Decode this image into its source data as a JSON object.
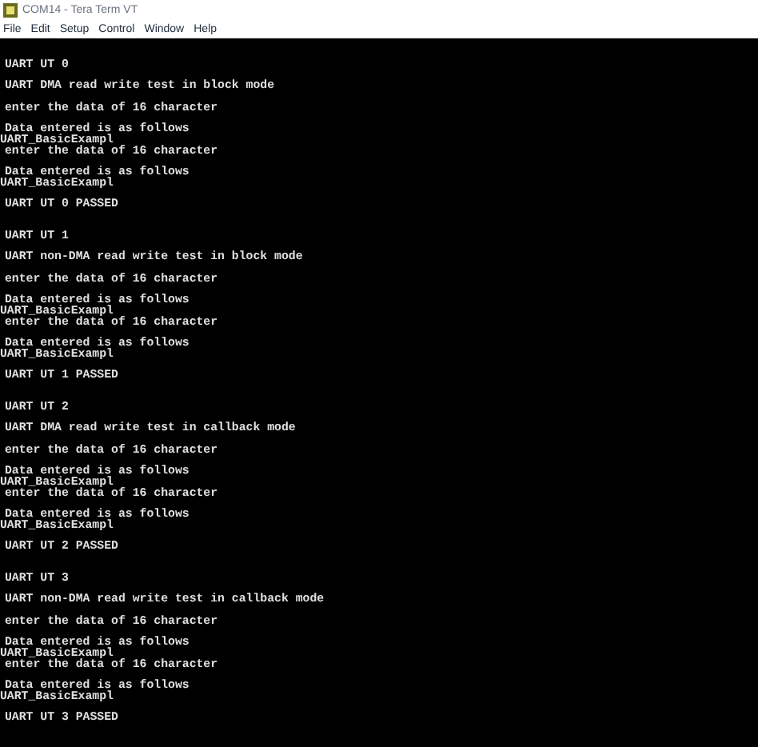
{
  "window": {
    "title": "COM14 - Tera Term VT"
  },
  "menu": [
    "File",
    "Edit",
    "Setup",
    "Control",
    "Window",
    "Help"
  ],
  "tests": [
    {
      "title": "UART UT 0",
      "description": "UART DMA read write test in block mode",
      "exchanges": [
        {
          "prompt": "enter the data of 16 character",
          "label": "Data entered is as follows",
          "response": "UART_BasicExampl"
        },
        {
          "prompt": "enter the data of 16 character",
          "label": "Data entered is as follows",
          "response": "UART_BasicExampl"
        }
      ],
      "result": "UART UT 0 PASSED"
    },
    {
      "title": "UART UT 1",
      "description": "UART non-DMA read write test in block mode",
      "exchanges": [
        {
          "prompt": "enter the data of 16 character",
          "label": "Data entered is as follows",
          "response": "UART_BasicExampl"
        },
        {
          "prompt": "enter the data of 16 character",
          "label": "Data entered is as follows",
          "response": "UART_BasicExampl"
        }
      ],
      "result": "UART UT 1 PASSED"
    },
    {
      "title": "UART UT 2",
      "description": "UART DMA read write test in callback mode",
      "exchanges": [
        {
          "prompt": "enter the data of 16 character",
          "label": "Data entered is as follows",
          "response": "UART_BasicExampl"
        },
        {
          "prompt": "enter the data of 16 character",
          "label": "Data entered is as follows",
          "response": "UART_BasicExampl"
        }
      ],
      "result": "UART UT 2 PASSED"
    },
    {
      "title": "UART UT 3",
      "description": "UART non-DMA read write test in callback mode",
      "exchanges": [
        {
          "prompt": "enter the data of 16 character",
          "label": "Data entered is as follows",
          "response": "UART_BasicExampl"
        },
        {
          "prompt": "enter the data of 16 character",
          "label": "Data entered is as follows",
          "response": "UART_BasicExampl"
        }
      ],
      "result": "UART UT 3 PASSED"
    }
  ]
}
